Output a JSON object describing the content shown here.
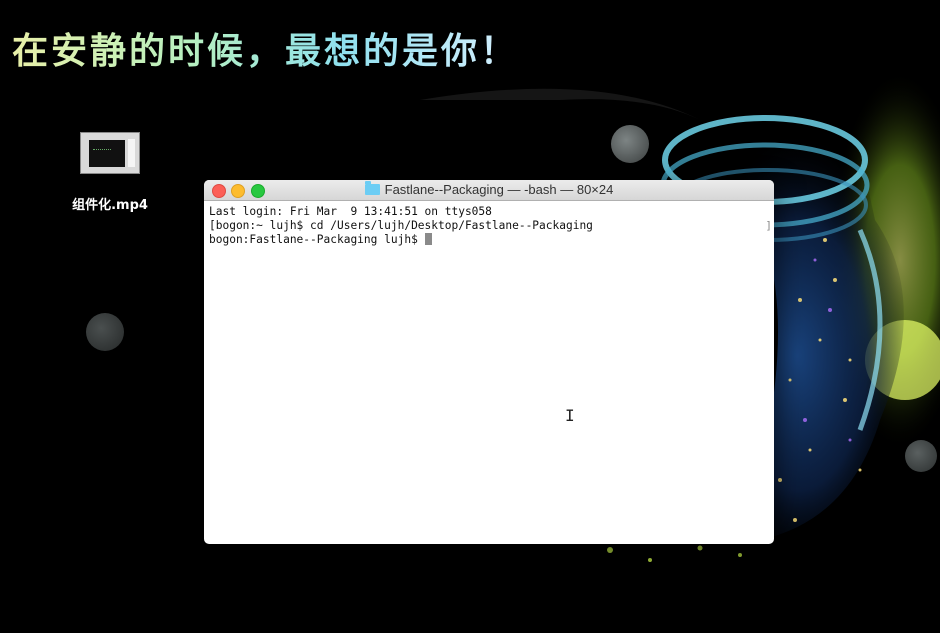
{
  "desktop": {
    "banner_text": "在安静的时候，最想的是你！",
    "file": {
      "name": "组件化.mp4",
      "icon": "video-thumbnail-icon"
    }
  },
  "terminal": {
    "title": "Fastlane--Packaging — -bash — 80×24",
    "folder_icon": "folder-icon",
    "lines": [
      "Last login: Fri Mar  9 13:41:51 on ttys058",
      "[bogon:~ lujh$ cd /Users/lujh/Desktop/Fastlane--Packaging",
      "bogon:Fastlane--Packaging lujh$ "
    ],
    "traffic_lights": {
      "close": "#fc5f57",
      "minimize": "#fdbc2e",
      "zoom": "#28c840"
    }
  },
  "colors": {
    "background": "#000000",
    "jar_glow": "#4fc3e8",
    "firefly": "#d8ff5a"
  }
}
